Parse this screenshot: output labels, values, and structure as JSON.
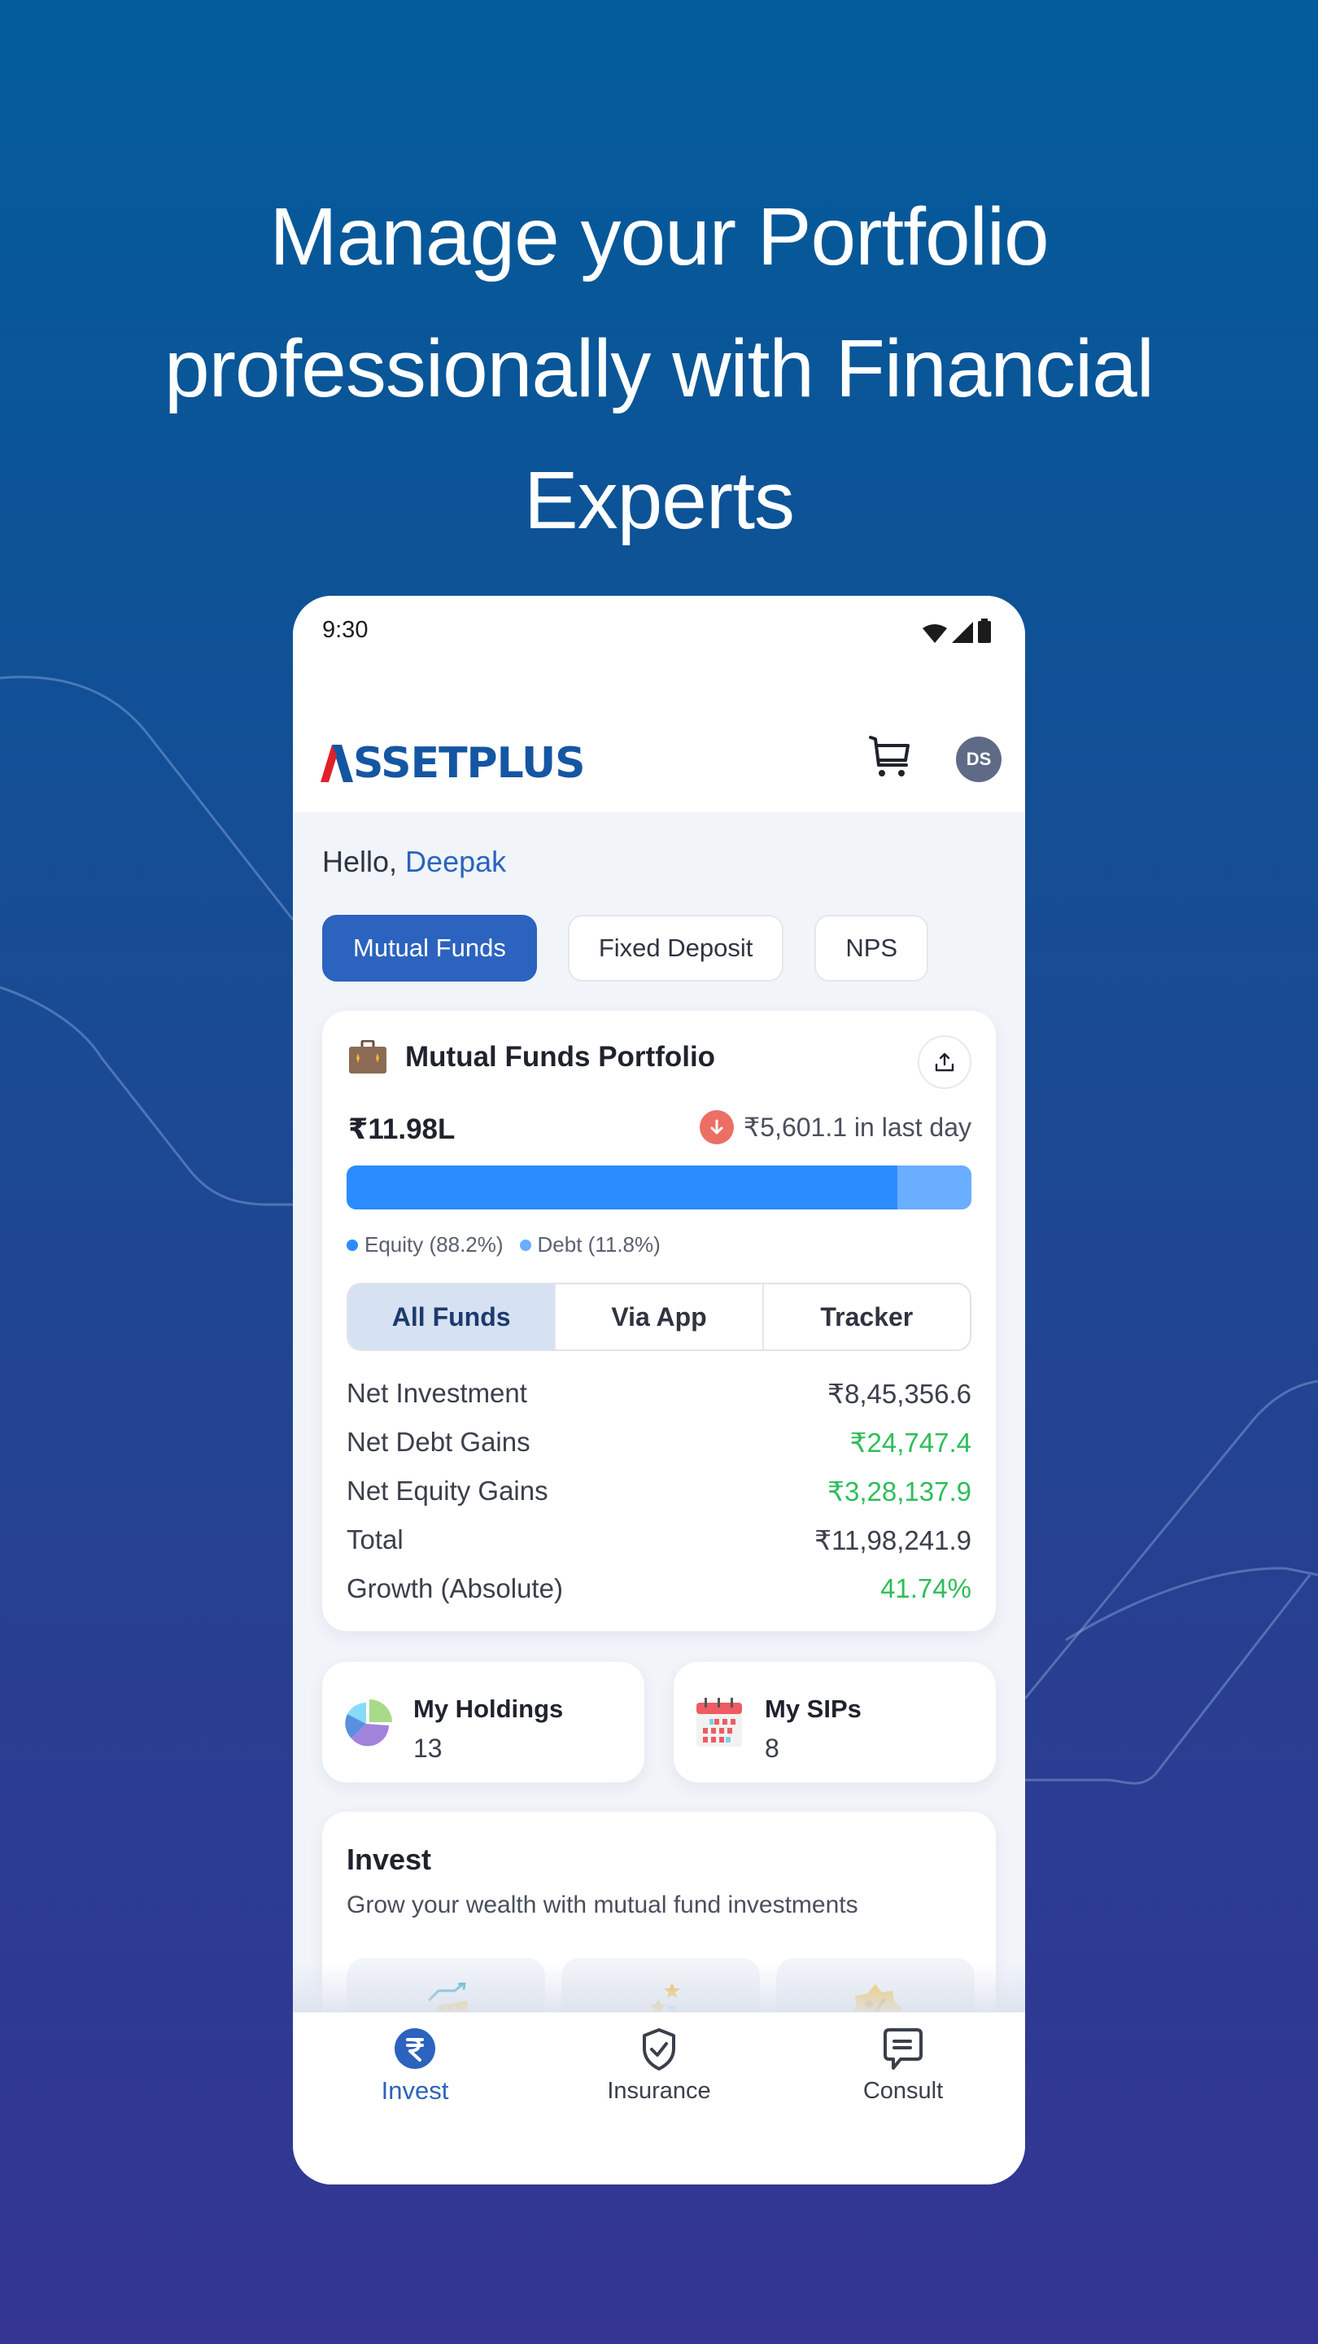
{
  "headline": {
    "lines": [
      "Manage your Portfolio",
      "professionally with Financial",
      "Experts"
    ]
  },
  "status_bar": {
    "time": "9:30",
    "icons": [
      "wifi-icon",
      "signal-icon",
      "battery-icon"
    ]
  },
  "app_bar": {
    "logo_text": "SSETPLUS",
    "logo_accent": "A",
    "brand_color": "#1556a3",
    "accent_color": "#e0202a",
    "cart_icon": "cart-icon",
    "avatar_initials": "DS"
  },
  "greeting": {
    "prefix": "Hello, ",
    "name": "Deepak"
  },
  "product_tabs": [
    {
      "label": "Mutual Funds",
      "active": true
    },
    {
      "label": "Fixed Deposit",
      "active": false
    },
    {
      "label": "NPS",
      "active": false
    }
  ],
  "portfolio": {
    "title": "Mutual Funds Portfolio",
    "icon": "briefcase-icon",
    "share_icon": "share-icon",
    "value": "₹11.98L",
    "change_direction": "down",
    "change_text": "₹5,601.1 in last day",
    "allocation": [
      {
        "label": "Equity (88.2%)",
        "percent": 88.2,
        "color": "#2a8cff"
      },
      {
        "label": "Debt (11.8%)",
        "percent": 11.8,
        "color": "#6aaeff"
      }
    ],
    "view_tabs": [
      {
        "label": "All Funds",
        "active": true
      },
      {
        "label": "Via App",
        "active": false
      },
      {
        "label": "Tracker",
        "active": false
      }
    ],
    "stats": [
      {
        "label": "Net Investment",
        "value": "₹8,45,356.6",
        "positive": false
      },
      {
        "label": "Net Debt Gains",
        "value": "₹24,747.4",
        "positive": true
      },
      {
        "label": "Net Equity Gains",
        "value": "₹3,28,137.9",
        "positive": true
      },
      {
        "label": "Total",
        "value": "₹11,98,241.9",
        "positive": false
      },
      {
        "label": "Growth (Absolute)",
        "value": "41.74%",
        "positive": true
      }
    ]
  },
  "summary_cards": [
    {
      "title": "My Holdings",
      "count": "13",
      "icon": "pie-chart-icon"
    },
    {
      "title": "My SIPs",
      "count": "8",
      "icon": "calendar-icon"
    }
  ],
  "invest": {
    "title": "Invest",
    "subtitle": "Grow your wealth with mutual fund investments",
    "tiles": [
      {
        "icon": "growth-chart-icon"
      },
      {
        "icon": "star-rating-icon"
      },
      {
        "icon": "discount-badge-icon"
      }
    ]
  },
  "bottom_nav": [
    {
      "label": "Invest",
      "icon": "rupee-icon",
      "active": true
    },
    {
      "label": "Insurance",
      "icon": "shield-check-icon",
      "active": false
    },
    {
      "label": "Consult",
      "icon": "chat-icon",
      "active": false
    }
  ],
  "colors": {
    "primary": "#2b63be",
    "positive": "#2fbd5a",
    "negative": "#ec6f66"
  }
}
